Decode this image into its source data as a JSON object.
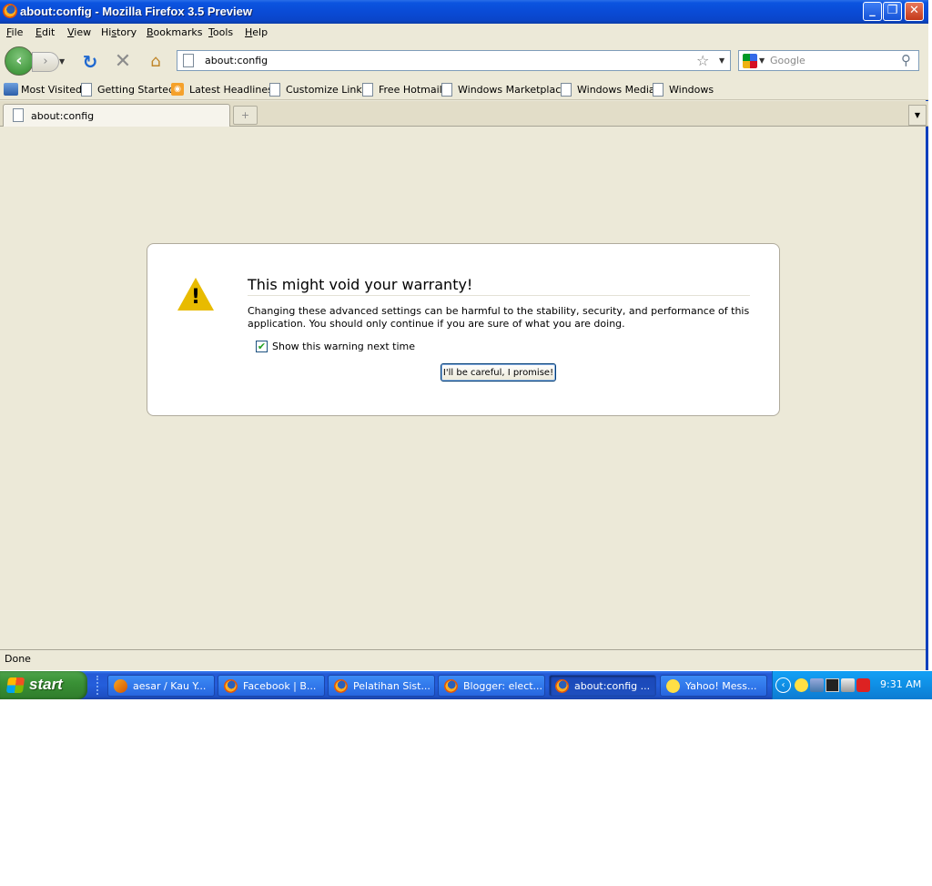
{
  "window": {
    "title": "about:config - Mozilla Firefox 3.5 Preview",
    "icon": "firefox-icon",
    "controls": {
      "minimize": "minimize-icon",
      "maximize": "restore-icon",
      "close": "close-icon"
    }
  },
  "menu": {
    "file": "File",
    "file_u": "F",
    "file_rest": "ile",
    "edit_u": "E",
    "edit_rest": "dit",
    "view_u": "V",
    "view_rest": "iew",
    "history_pre": "Hi",
    "history_u": "s",
    "history_rest": "tory",
    "bookmarks_u": "B",
    "bookmarks_rest": "ookmarks",
    "tools_u": "T",
    "tools_rest": "ools",
    "help_u": "H",
    "help_rest": "elp"
  },
  "navbar": {
    "url": "about:config",
    "search_placeholder": "Google"
  },
  "bookmarks": [
    "Most Visited",
    "Getting Started",
    "Latest Headlines",
    "Customize Links",
    "Free Hotmail",
    "Windows Marketplace",
    "Windows Media",
    "Windows"
  ],
  "tabs": {
    "active_label": "about:config",
    "new_tab_glyph": "+"
  },
  "warning": {
    "title": "This might void your warranty!",
    "description": "Changing these advanced settings can be harmful to the stability, security, and performance of this application. You should only continue if you are sure of what you are doing.",
    "checkbox_label": "Show this warning next time",
    "checkbox_checked": true,
    "button_label": "I'll be careful, I promise!"
  },
  "status": {
    "text": "Done"
  },
  "taskbar": {
    "start_label": "start",
    "tasks": [
      {
        "label": "aesar / Kau Y...",
        "icon": "aim-icon"
      },
      {
        "label": "Facebook | B...",
        "icon": "firefox-icon"
      },
      {
        "label": "Pelatihan Sist...",
        "icon": "firefox-icon"
      },
      {
        "label": "Blogger: elect...",
        "icon": "firefox-icon"
      },
      {
        "label": "about:config ...",
        "icon": "firefox-icon",
        "active": true
      },
      {
        "label": "Yahoo! Mess...",
        "icon": "yahoo-messenger-icon"
      }
    ],
    "clock": "9:31 AM"
  }
}
